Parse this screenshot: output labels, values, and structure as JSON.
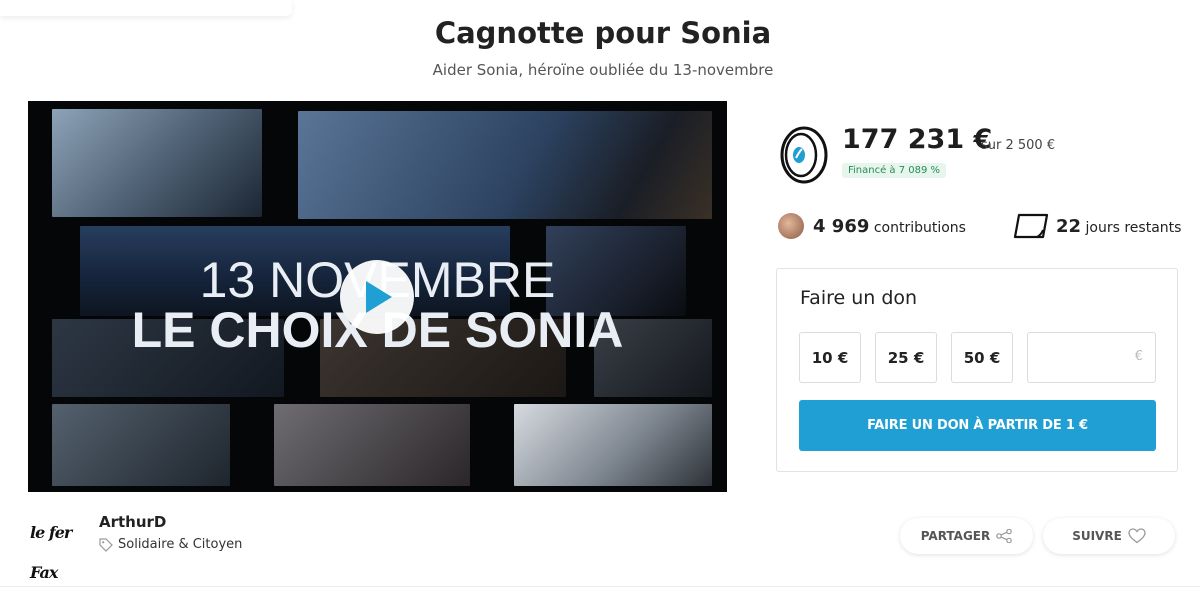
{
  "page": {
    "title": "Cagnotte pour Sonia",
    "subtitle": "Aider Sonia, héroïne oubliée du 13-novembre"
  },
  "video": {
    "overlay_line1": "13 NOVEMBRE",
    "overlay_line2": "LE CHOIX DE SONIA",
    "play_icon": "play-icon"
  },
  "stats": {
    "amount": "177 231 €",
    "target": "sur 2 500 €",
    "funded": "Financé à 7 089 %",
    "contributions_count": "4 969",
    "contributions_label": "contributions",
    "days_count": "22",
    "days_label": "jours restants"
  },
  "donate": {
    "title": "Faire un don",
    "amounts": [
      "10 €",
      "25 €",
      "50 €"
    ],
    "custom_placeholder": "",
    "currency": "€",
    "cta": "FAIRE UN DON À PARTIR DE 1 €"
  },
  "organizer": {
    "logo_text": "le fer Fax",
    "name": "ArthurD",
    "category": "Solidaire & Citoyen"
  },
  "actions": {
    "share": "PARTAGER",
    "follow": "SUIVRE"
  },
  "colors": {
    "accent": "#1f9fd3",
    "funded_bg": "#e6f6ec",
    "funded_text": "#2a8a5a"
  }
}
